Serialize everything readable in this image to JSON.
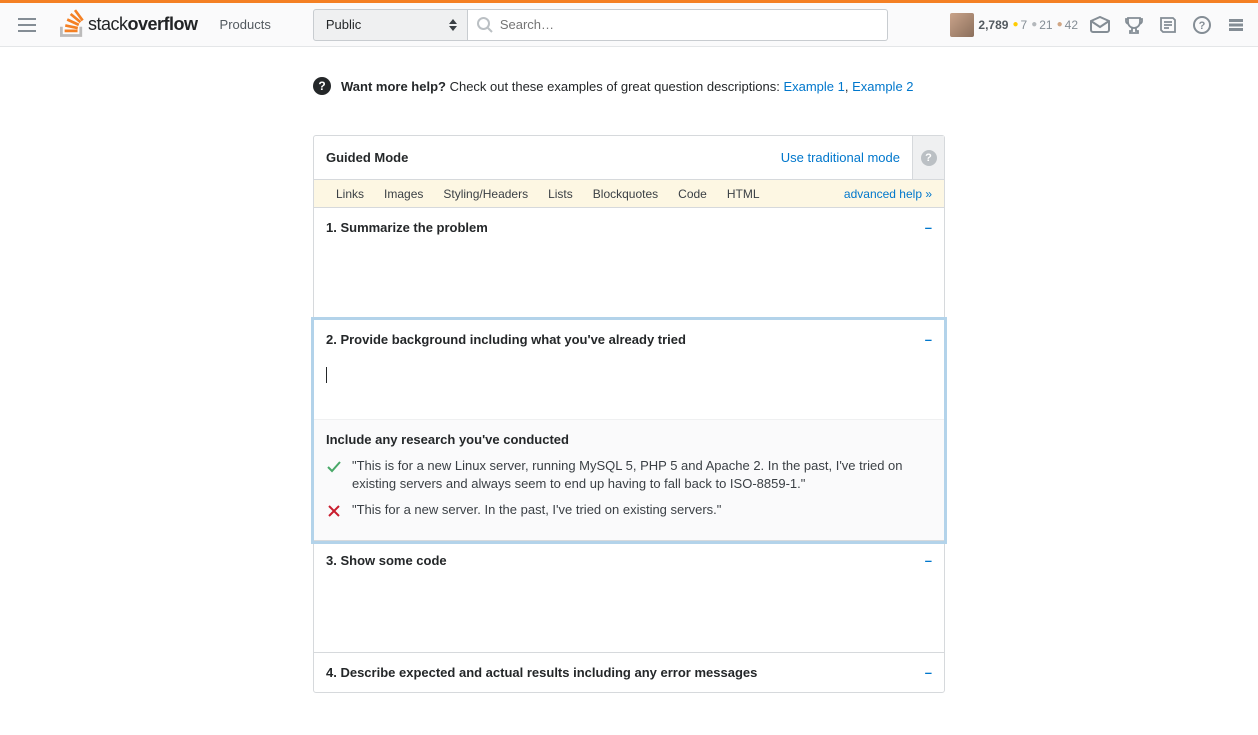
{
  "header": {
    "products": "Products",
    "scope": "Public",
    "search_placeholder": "Search…",
    "reputation": "2,789",
    "gold": "7",
    "silver": "21",
    "bronze": "42"
  },
  "banner": {
    "bold": "Want more help?",
    "text": " Check out these examples of great question descriptions: ",
    "link1": "Example 1",
    "sep": ", ",
    "link2": "Example 2"
  },
  "panel": {
    "title": "Guided Mode",
    "traditional": "Use traditional mode",
    "tabs": [
      "Links",
      "Images",
      "Styling/Headers",
      "Lists",
      "Blockquotes",
      "Code",
      "HTML"
    ],
    "advanced": "advanced help »"
  },
  "steps": {
    "s1": "1. Summarize the problem",
    "s2": "2. Provide background including what you've already tried",
    "s3": "3. Show some code",
    "s4": "4. Describe expected and actual results including any error messages"
  },
  "hint": {
    "title": "Include any research you've conducted",
    "good": "\"This is for a new Linux server, running MySQL 5, PHP 5 and Apache 2. In the past, I've tried on existing servers and always seem to end up having to fall back to ISO-8859-1.\"",
    "bad": "\"This for a new server. In the past, I've tried on existing servers.\""
  }
}
